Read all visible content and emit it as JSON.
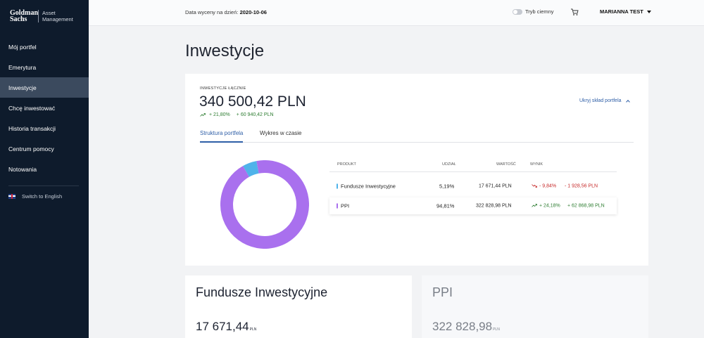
{
  "brand": {
    "name_line1": "Goldman",
    "name_line2": "Sachs",
    "sub_line1": "Asset",
    "sub_line2": "Management"
  },
  "nav": {
    "items": [
      "Mój portfel",
      "Emerytura",
      "Inwestycje",
      "Chcę inwestować",
      "Historia transakcji",
      "Centrum pomocy",
      "Notowania"
    ],
    "active_index": 2,
    "language_label": "Switch to English"
  },
  "topbar": {
    "date_label": "Data wyceny na dzień:",
    "date_value": "2020-10-06",
    "dark_mode_label": "Tryb ciemny",
    "user_name": "MARIANNA TEST"
  },
  "page": {
    "title": "Inwestycje"
  },
  "summary": {
    "label": "INWESTYCJE ŁĄCZNIE",
    "total": "340 500,42 PLN",
    "change_percent": "+ 21,80%",
    "change_value": "+ 60 940,42 PLN",
    "hide_link": "Ukryj skład portfela"
  },
  "tabs": [
    "Struktura portfela",
    "Wykres w czasie"
  ],
  "table": {
    "headers": [
      "PRODUKT",
      "UDZIAŁ",
      "WARTOŚĆ",
      "WYNIK"
    ],
    "rows": [
      {
        "product": "Fundusze Inwestycyjne",
        "share": "5,19%",
        "value": "17 671,44 PLN",
        "result_percent": "- 9,84%",
        "result_value": "- 1 928,56 PLN",
        "trend": "down",
        "color": "#4fb3ea"
      },
      {
        "product": "PPI",
        "share": "94,81%",
        "value": "322 828,98 PLN",
        "result_percent": "+ 24,18%",
        "result_value": "+ 62 868,98 PLN",
        "trend": "up",
        "color": "#a970ee"
      }
    ]
  },
  "chart_data": {
    "type": "pie",
    "categories": [
      "Fundusze Inwestycyjne",
      "PPI"
    ],
    "values": [
      5.19,
      94.81
    ],
    "colors": [
      "#4fb3ea",
      "#a970ee"
    ]
  },
  "cards": [
    {
      "title": "Fundusze Inwestycyjne",
      "value": "17 671,44",
      "currency": "PLN"
    },
    {
      "title": "PPI",
      "value": "322 828,98",
      "currency": "PLN"
    }
  ]
}
